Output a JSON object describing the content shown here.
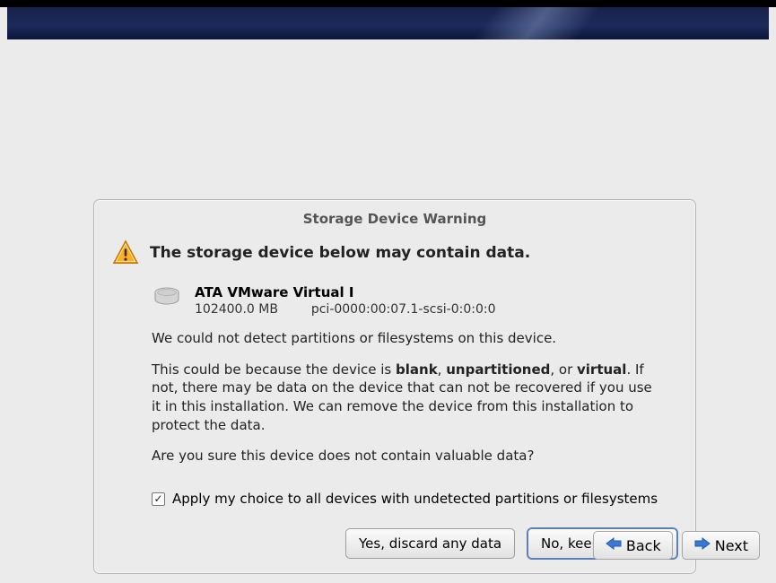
{
  "app": "installer",
  "dialog": {
    "title": "Storage Device Warning",
    "heading": "The storage device below may contain data.",
    "device": {
      "name": "ATA VMware Virtual I",
      "size": "102400.0 MB",
      "path": "pci-0000:00:07.1-scsi-0:0:0:0"
    },
    "para1": "We could not detect partitions or filesystems on this device.",
    "para2_1": "This could be because the device is ",
    "para2_b1": "blank",
    "para2_2": ", ",
    "para2_b2": "unpartitioned",
    "para2_3": ",\nor ",
    "para2_b3": "virtual",
    "para2_4": ". If not, there may be data on the device that can not be recovered if you use it in this installation. We can remove the device from this installation to protect the data.",
    "para3": "Are you sure this device does not contain valuable data?",
    "checkbox_label": "Apply my choice to all devices with undetected partitions or filesystems",
    "checkbox_checked": true,
    "btn_discard": "Yes, discard any data",
    "btn_keep": "No, keep any data"
  },
  "nav": {
    "back": "Back",
    "next": "Next"
  },
  "icons": {
    "warning": "warning-icon",
    "drive": "harddrive-icon",
    "arrow_back": "arrow-left-icon",
    "arrow_next": "arrow-right-icon"
  }
}
